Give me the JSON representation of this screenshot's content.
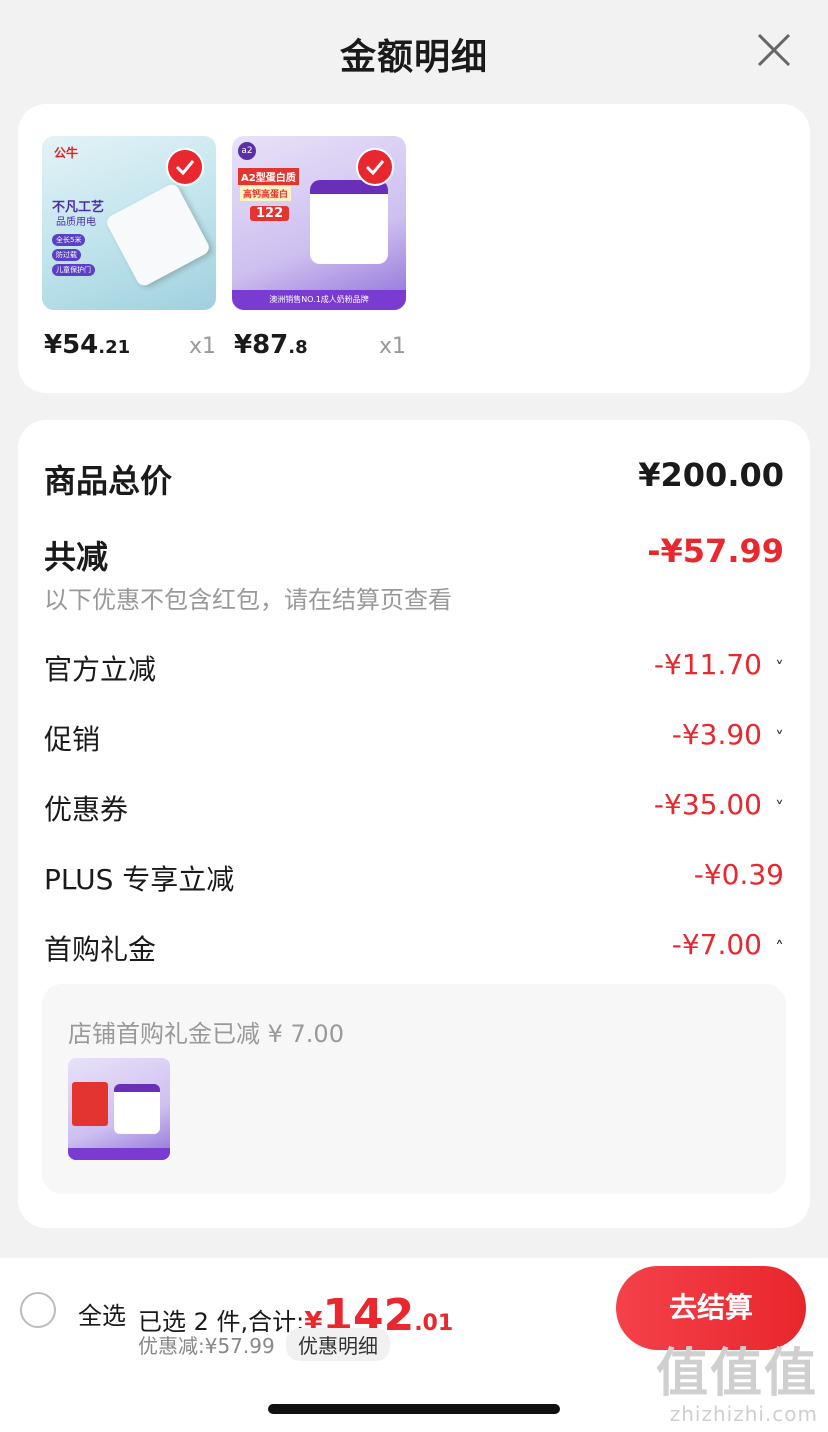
{
  "header": {
    "title": "金额明细"
  },
  "products": [
    {
      "price_main": "¥54",
      "price_dec": ".21",
      "qty": "x1",
      "brand": "公牛",
      "promo1": "不凡工艺",
      "promo2": "品质用电",
      "tag1": "全长5米",
      "tag2": "防过载",
      "tag3": "儿童保护门"
    },
    {
      "price_main": "¥87",
      "price_dec": ".8",
      "qty": "x1",
      "brand": "a2",
      "promo1": "A2型蛋白质",
      "promo2": "高钙高蛋白",
      "value": "122",
      "footer": "澳洲销售NO.1成人奶粉品牌"
    }
  ],
  "summary": {
    "total_label": "商品总价",
    "total_value": "¥200.00",
    "reduce_label": "共减",
    "reduce_value": "-¥57.99",
    "note": "以下优惠不包含红包，请在结算页查看",
    "items": [
      {
        "label": "官方立减",
        "value": "-¥11.70",
        "chevron": "˅"
      },
      {
        "label": "促销",
        "value": "-¥3.90",
        "chevron": "˅"
      },
      {
        "label": "优惠券",
        "value": "-¥35.00",
        "chevron": "˅"
      },
      {
        "label": "PLUS 专享立减",
        "value": "-¥0.39",
        "chevron": ""
      },
      {
        "label": "首购礼金",
        "value": "-¥7.00",
        "chevron": "˄"
      }
    ],
    "gift_text": "店铺首购礼金已减 ¥ 7.00"
  },
  "bottom": {
    "select_all": "全选",
    "selected_prefix": "已选 2 件,合计:",
    "sum_currency": "¥",
    "sum_int": "142",
    "sum_dec": ".01",
    "discount": "优惠减:¥57.99",
    "discount_detail": "优惠明细",
    "checkout": "去结算"
  },
  "watermark": {
    "big": "值值值",
    "small": "zhizhizhi.com"
  },
  "colors": {
    "accent": "#e8282e",
    "background": "#f2f2f2"
  }
}
